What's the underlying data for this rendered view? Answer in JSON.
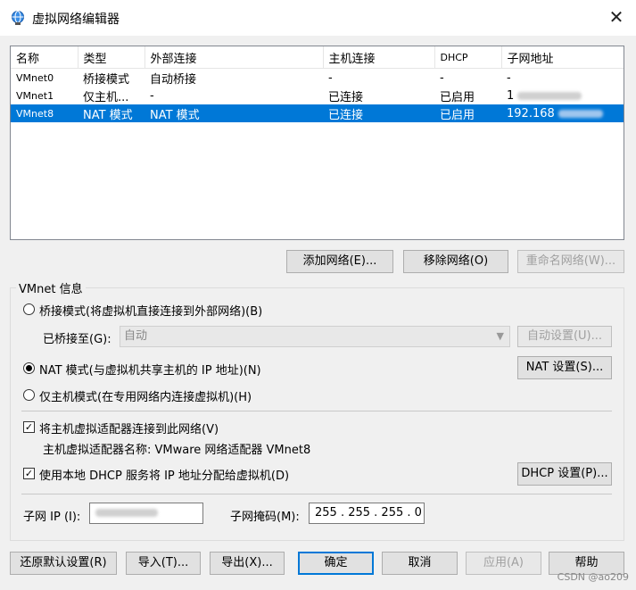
{
  "window": {
    "title": "虚拟网络编辑器",
    "icon": "network-globe-icon",
    "close_label": "✕"
  },
  "table": {
    "columns": [
      "名称",
      "类型",
      "外部连接",
      "主机连接",
      "DHCP",
      "子网地址"
    ],
    "rows": [
      {
        "name": "VMnet0",
        "type": "桥接模式",
        "external": "自动桥接",
        "host": "-",
        "dhcp": "-",
        "subnet": "-"
      },
      {
        "name": "VMnet1",
        "type": "仅主机...",
        "external": "-",
        "host": "已连接",
        "dhcp": "已启用",
        "subnet": "1"
      },
      {
        "name": "VMnet8",
        "type": "NAT 模式",
        "external": "NAT 模式",
        "host": "已连接",
        "dhcp": "已启用",
        "subnet": "192.168"
      }
    ],
    "selected_row": 2
  },
  "net_buttons": {
    "add": "添加网络(E)...",
    "remove": "移除网络(O)",
    "rename": "重命名网络(W)..."
  },
  "vmnet_info": {
    "legend": "VMnet 信息",
    "bridged_label": "桥接模式(将虚拟机直接连接到外部网络)(B)",
    "bridged_to_label": "已桥接至(G):",
    "bridged_to_value": "自动",
    "auto_settings": "自动设置(U)...",
    "nat_label": "NAT 模式(与虚拟机共享主机的 IP 地址)(N)",
    "nat_settings": "NAT 设置(S)...",
    "hostonly_label": "仅主机模式(在专用网络内连接虚拟机)(H)",
    "connect_adapter_label": "将主机虚拟适配器连接到此网络(V)",
    "adapter_name_label": "主机虚拟适配器名称: VMware 网络适配器 VMnet8",
    "use_dhcp_label": "使用本地 DHCP 服务将 IP 地址分配给虚拟机(D)",
    "dhcp_settings": "DHCP 设置(P)...",
    "subnet_ip_label": "子网 IP (I):",
    "subnet_ip_value": "",
    "subnet_mask_label": "子网掩码(M):",
    "subnet_mask_value": "255 . 255 . 255 . 0"
  },
  "footer": {
    "restore": "还原默认设置(R)",
    "import": "导入(T)...",
    "export": "导出(X)...",
    "ok": "确定",
    "cancel": "取消",
    "apply": "应用(A)",
    "help": "帮助"
  },
  "watermark": "CSDN @ao209",
  "colors": {
    "selection": "#0078d7",
    "background": "#f0f0f0"
  }
}
